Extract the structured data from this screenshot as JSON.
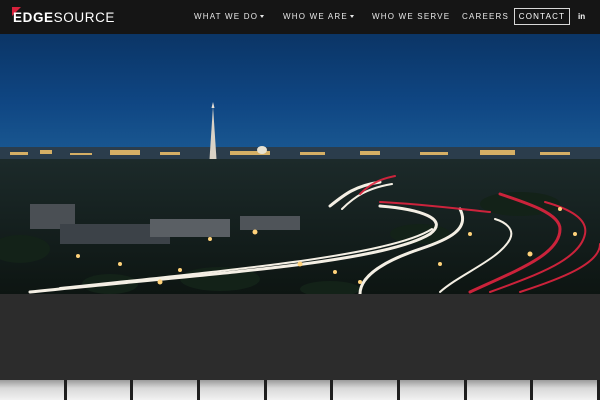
{
  "header": {
    "logo": {
      "part1": "EDGE",
      "part2": "SOURCE"
    },
    "nav": [
      {
        "label": "WHAT WE DO",
        "has_dropdown": true
      },
      {
        "label": "WHO WE ARE",
        "has_dropdown": true
      },
      {
        "label": "WHO WE SERVE",
        "has_dropdown": false
      },
      {
        "label": "CAREERS",
        "has_dropdown": false
      }
    ],
    "contact_label": "CONTACT",
    "social_label": "in"
  },
  "colors": {
    "header_bg": "#151515",
    "accent_red": "#d6213b",
    "sky_top": "#0c3a6e",
    "body_bg": "#2a2a2a"
  },
  "hero": {
    "icon": "hero-image"
  }
}
